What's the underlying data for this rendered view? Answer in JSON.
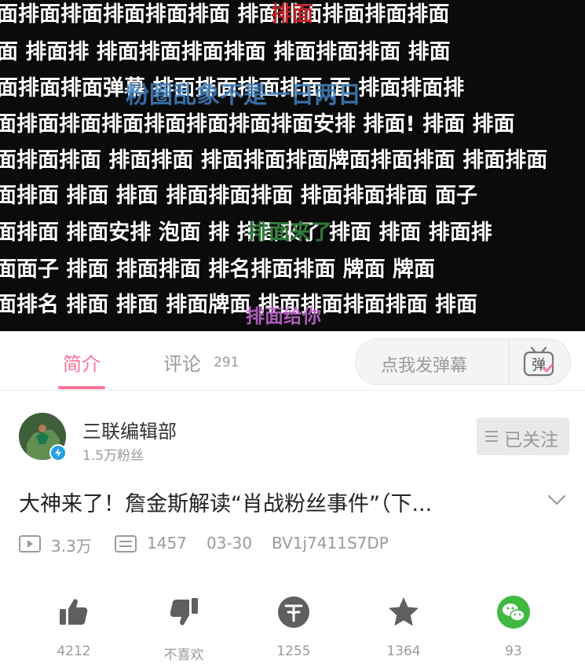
{
  "video": {
    "danmaku_rows": [
      "面排面排面排面排面排面 排面排面排面排面排面",
      "面  排面排 排面排面排面排面 排面排面排面 排面",
      "面排面排面弹幕  排面排面排面排面 面  排面排面排",
      "面排面排面排面排面排面排面排面安排 排面! 排面  排面",
      "面排面排面 排面排面  排面排面排面牌面排面排面 排面排面",
      "面排面  排面  排面  排面排面排面 排面排面排面  面子",
      "面排面 排面安排  泡面  排 排面来了  排面  排面  排面排",
      "面面子  排面  排面排面 排名排面排面 牌面  牌面",
      "面排名 排面 排面 排面牌面 排面排面排面排面  排面"
    ],
    "overlay_green": "排面来了",
    "overlay_red": "排面",
    "overlay_blue": "粉圈乱象不是一日两日",
    "overlay_purple": "排面给你"
  },
  "tabs": {
    "intro": "简介",
    "comments": "评论",
    "comments_count": "291"
  },
  "danmaku_input": {
    "placeholder": "点我发弹幕",
    "icon_char": "弹"
  },
  "uploader": {
    "name": "三联编辑部",
    "fans": "1.5万粉丝",
    "follow_label": "已关注"
  },
  "video_info": {
    "title": "大神来了！詹金斯解读“肖战粉丝事件”（下...",
    "views": "3.3万",
    "danmaku_count": "1457",
    "date": "03-30",
    "bvid": "BV1j7411S7DP"
  },
  "actions": {
    "like": "4212",
    "dislike": "不喜欢",
    "coin": "1255",
    "favorite": "1364",
    "share": "93"
  },
  "colors": {
    "accent": "#fb7299",
    "muted": "#9a9a9a",
    "wechat": "#3fb93f"
  }
}
